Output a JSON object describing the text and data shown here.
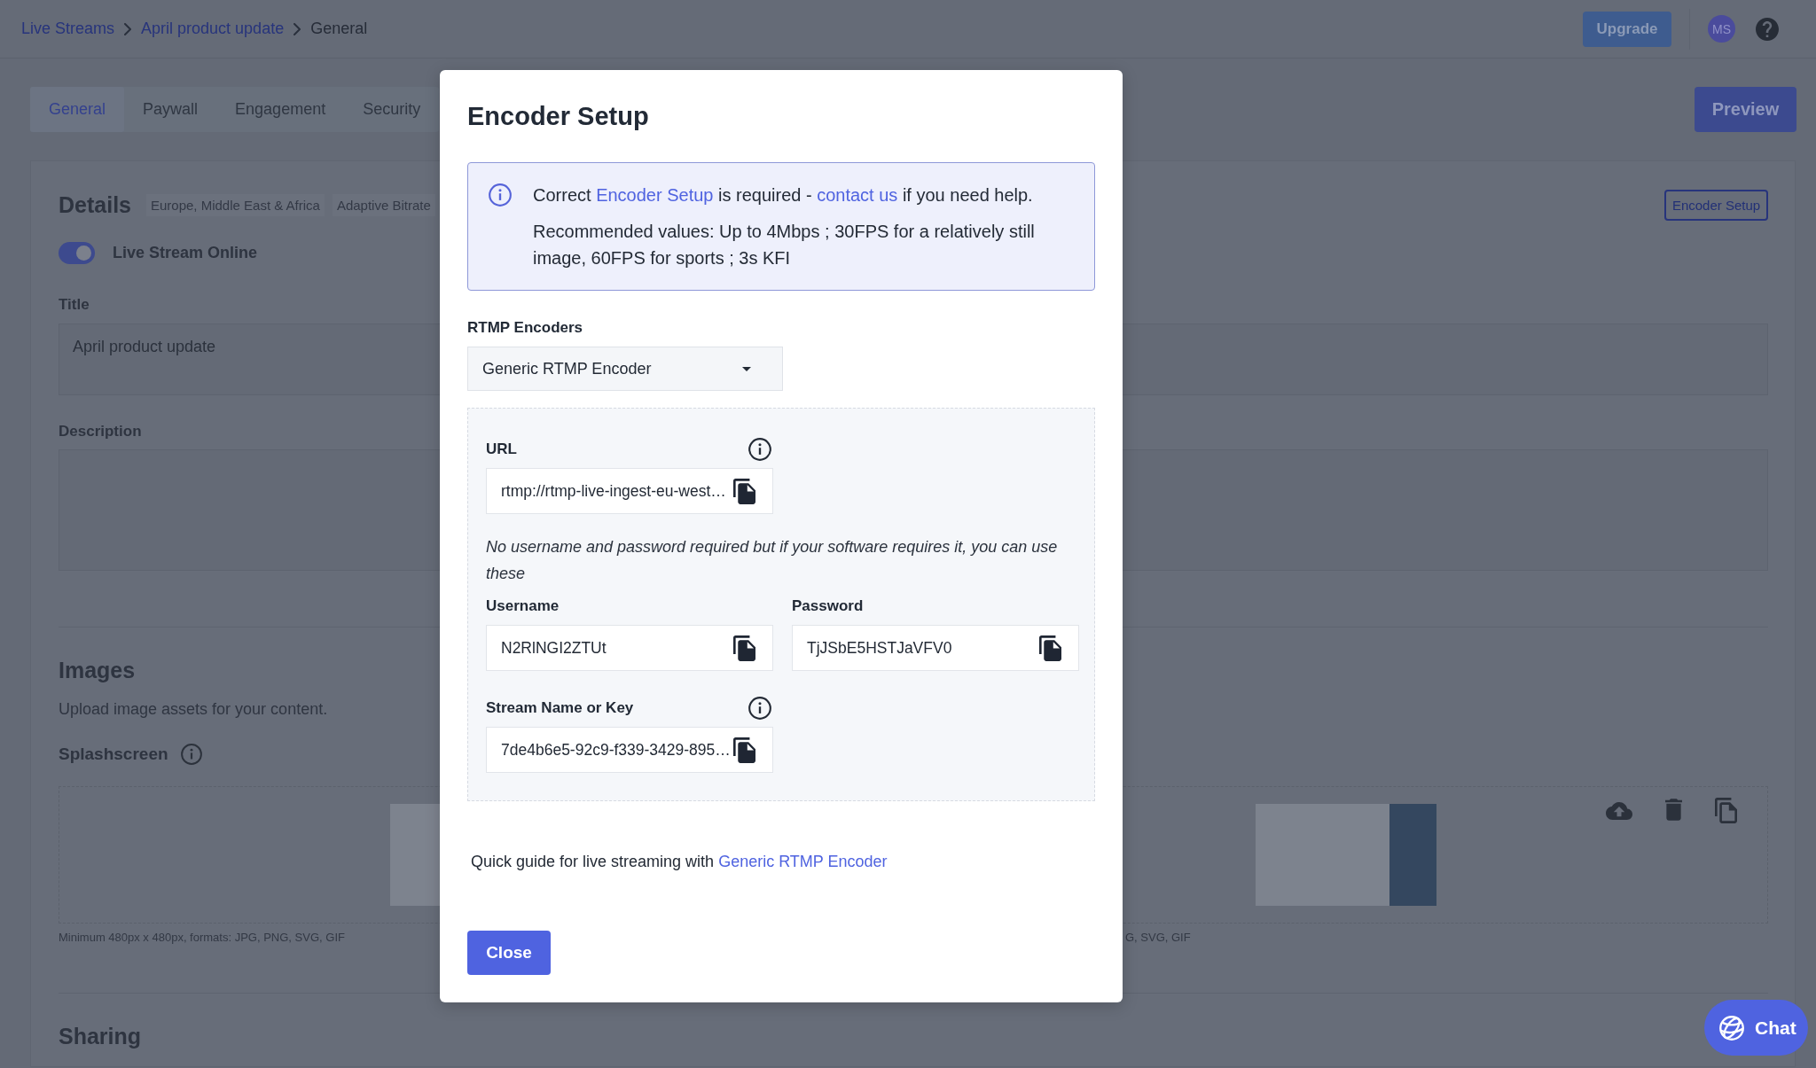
{
  "header": {
    "breadcrumbs": [
      {
        "label": "Live Streams",
        "current": false
      },
      {
        "label": "April product update",
        "current": false
      },
      {
        "label": "General",
        "current": true
      }
    ],
    "upgrade_button": "Upgrade",
    "avatar": "MS"
  },
  "tabs": [
    {
      "label": "General",
      "selected": true
    },
    {
      "label": "Paywall",
      "selected": false
    },
    {
      "label": "Engagement",
      "selected": false
    },
    {
      "label": "Security",
      "selected": false
    }
  ],
  "preview_button": "Preview",
  "details": {
    "heading": "Details",
    "tags": [
      "Europe, Middle East & Africa",
      "Adaptive Bitrate"
    ],
    "encoder_setup_button": "Encoder Setup",
    "live_toggle": {
      "label": "Live Stream Online",
      "on": true
    },
    "title_field": {
      "label": "Title",
      "value": "April product update"
    },
    "description_field": {
      "label": "Description"
    }
  },
  "images": {
    "heading": "Images",
    "subtitle": "Upload image assets for your content.",
    "splashscreen": {
      "label": "Splashscreen",
      "upload_slots": [
        {
          "hint": "Minimum 480px x 480px, formats: JPG, PNG, SVG, GIF"
        },
        {
          "hint": "G, SVG, GIF"
        }
      ]
    }
  },
  "sharing": {
    "heading": "Sharing"
  },
  "chat_button": "Chat",
  "modal": {
    "title": "Encoder Setup",
    "notice": {
      "message": [
        {
          "text": "Correct ",
          "link": false
        },
        {
          "text": "Encoder Setup",
          "link": true
        },
        {
          "text": " is required - ",
          "link": false
        },
        {
          "text": "contact us",
          "link": true
        },
        {
          "text": " if you need help.",
          "link": false
        }
      ],
      "recommendation": "Recommended values: Up to 4Mbps ; 30FPS for a relatively still image, 60FPS for sports ; 3s KFI"
    },
    "encoder_select": {
      "label": "RTMP Encoders",
      "value": "Generic RTMP Encoder"
    },
    "connection": {
      "url": {
        "label": "URL",
        "value": "rtmp://rtmp-live-ingest-eu-west…",
        "info": true
      },
      "note": "No username and password required but if your software requires it, you can use these",
      "username": {
        "label": "Username",
        "value": "N2RlNGI2ZTUt",
        "info": false
      },
      "password": {
        "label": "Password",
        "value": "TjJSbE5HSTJaVFV0",
        "info": false
      },
      "stream_key": {
        "label": "Stream Name or Key",
        "value": "7de4b6e5-92c9-f339-3429-895…",
        "info": true
      }
    },
    "guide": [
      {
        "text": "Quick guide for live streaming with ",
        "link": false
      },
      {
        "text": "Generic RTMP Encoder",
        "link": true
      }
    ],
    "close_button": "Close"
  }
}
